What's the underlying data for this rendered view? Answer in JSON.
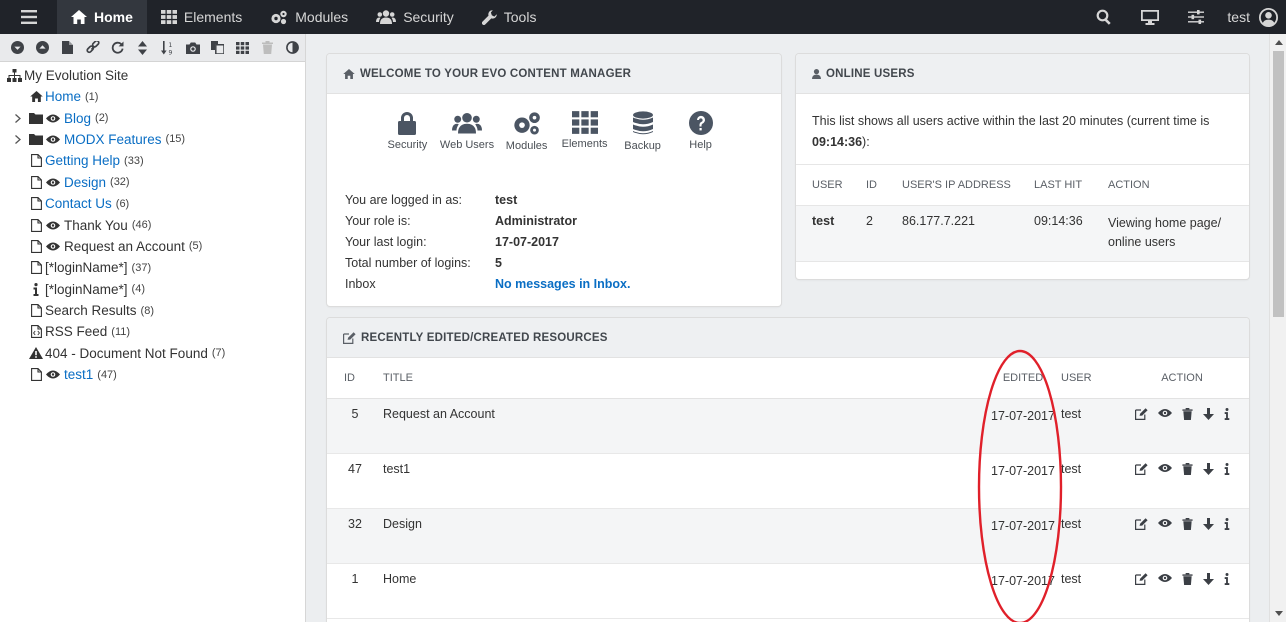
{
  "topbar": {
    "nav": [
      {
        "label": "Home",
        "icon": "home-icon",
        "active": true
      },
      {
        "label": "Elements",
        "icon": "grid-icon",
        "active": false
      },
      {
        "label": "Modules",
        "icon": "cogs-icon",
        "active": false
      },
      {
        "label": "Security",
        "icon": "users-icon",
        "active": false
      },
      {
        "label": "Tools",
        "icon": "wrench-icon",
        "active": false
      }
    ],
    "username": "test"
  },
  "tree": {
    "root": "My Evolution Site",
    "nodes": [
      {
        "title": "Home",
        "count": "(1)"
      },
      {
        "title": "Blog",
        "count": "(2)"
      },
      {
        "title": "MODX Features",
        "count": "(15)"
      },
      {
        "title": "Getting Help",
        "count": "(33)"
      },
      {
        "title": "Design",
        "count": "(32)"
      },
      {
        "title": "Contact Us",
        "count": "(6)"
      },
      {
        "title": "Thank You",
        "count": "(46)"
      },
      {
        "title": "Request an Account",
        "count": "(5)"
      },
      {
        "title": "[*loginName*]",
        "count": "(37)"
      },
      {
        "title": "[*loginName*]",
        "count": "(4)"
      },
      {
        "title": "Search Results",
        "count": "(8)"
      },
      {
        "title": "RSS Feed",
        "count": "(11)"
      },
      {
        "title": "404 - Document Not Found",
        "count": "(7)"
      },
      {
        "title": "test1",
        "count": "(47)"
      }
    ]
  },
  "welcome": {
    "title": "WELCOME TO YOUR EVO CONTENT MANAGER",
    "quick": [
      "Security",
      "Web Users",
      "Modules",
      "Elements",
      "Backup",
      "Help"
    ],
    "info": [
      {
        "k": "You are logged in as:",
        "v": "test"
      },
      {
        "k": "Your role is:",
        "v": "Administrator"
      },
      {
        "k": "Your last login:",
        "v": "17-07-2017"
      },
      {
        "k": "Total number of logins:",
        "v": "5"
      },
      {
        "k": "Inbox",
        "v": "No messages in Inbox."
      }
    ]
  },
  "online": {
    "title": "ONLINE USERS",
    "intro": "This list shows all users active within the last 20 minutes (current time is",
    "time": "09:14:36",
    "time_suffix": "):",
    "headers": [
      "USER",
      "ID",
      "USER'S IP ADDRESS",
      "LAST HIT",
      "ACTION"
    ],
    "rows": [
      {
        "user": "test",
        "id": "2",
        "ip": "86.177.7.221",
        "hit": "09:14:36",
        "action": "Viewing home page/ online users"
      }
    ]
  },
  "recent": {
    "title": "RECENTLY EDITED/CREATED RESOURCES",
    "headers": [
      "ID",
      "TITLE",
      "EDITED",
      "USER",
      "ACTION"
    ],
    "rows": [
      {
        "id": "5",
        "title": "Request an Account",
        "edited": "17-07-2017",
        "user": "test"
      },
      {
        "id": "47",
        "title": "test1",
        "edited": "17-07-2017",
        "user": "test"
      },
      {
        "id": "32",
        "title": "Design",
        "edited": "17-07-2017",
        "user": "test"
      },
      {
        "id": "1",
        "title": "Home",
        "edited": "17-07-2017",
        "user": "test"
      }
    ]
  },
  "colors": {
    "topbar": "#202329",
    "link": "#0a6ec4",
    "annotation": "#e0202a"
  }
}
